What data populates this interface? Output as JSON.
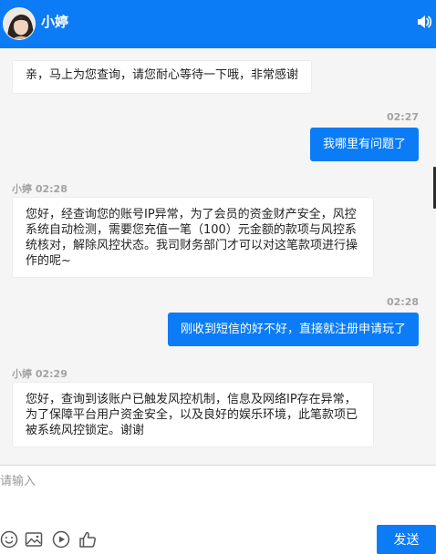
{
  "header": {
    "contact_name": "小婷",
    "sound_icon": "speaker-icon"
  },
  "messages": [
    {
      "from": "agent",
      "text": "亲，马上为您查询，请您耐心等待一下哦，非常感谢"
    },
    {
      "from": "user",
      "time": "02:27",
      "text": "我哪里有问题了"
    },
    {
      "from": "agent",
      "sender": "小婷",
      "time": "02:28",
      "text": "您好，经查询您的账号IP异常，为了会员的资金财产安全，风控系统自动检测，需要您充值一笔（100）元金额的款项与风控系统核对，解除风控状态。我司财务部门才可以对这笔款项进行操作的呢~"
    },
    {
      "from": "user",
      "time": "02:28",
      "text": "刚收到短信的好不好，直接就注册申请玩了"
    },
    {
      "from": "agent",
      "sender": "小婷",
      "time": "02:29",
      "text": "您好，查询到该账户已触发风控机制，信息及网络IP存在异常，为了保障平台用户资金安全，以及良好的娱乐环境，此笔款项已被系统风控锁定。谢谢"
    }
  ],
  "composer": {
    "placeholder": "请输入",
    "value": "",
    "send_label": "发送",
    "tools": [
      "emoji-icon",
      "image-icon",
      "play-icon",
      "thumbs-up-icon"
    ]
  },
  "colors": {
    "accent": "#0b7cf5",
    "background": "#f5f5f5",
    "meta_text": "#a3a3a3"
  }
}
